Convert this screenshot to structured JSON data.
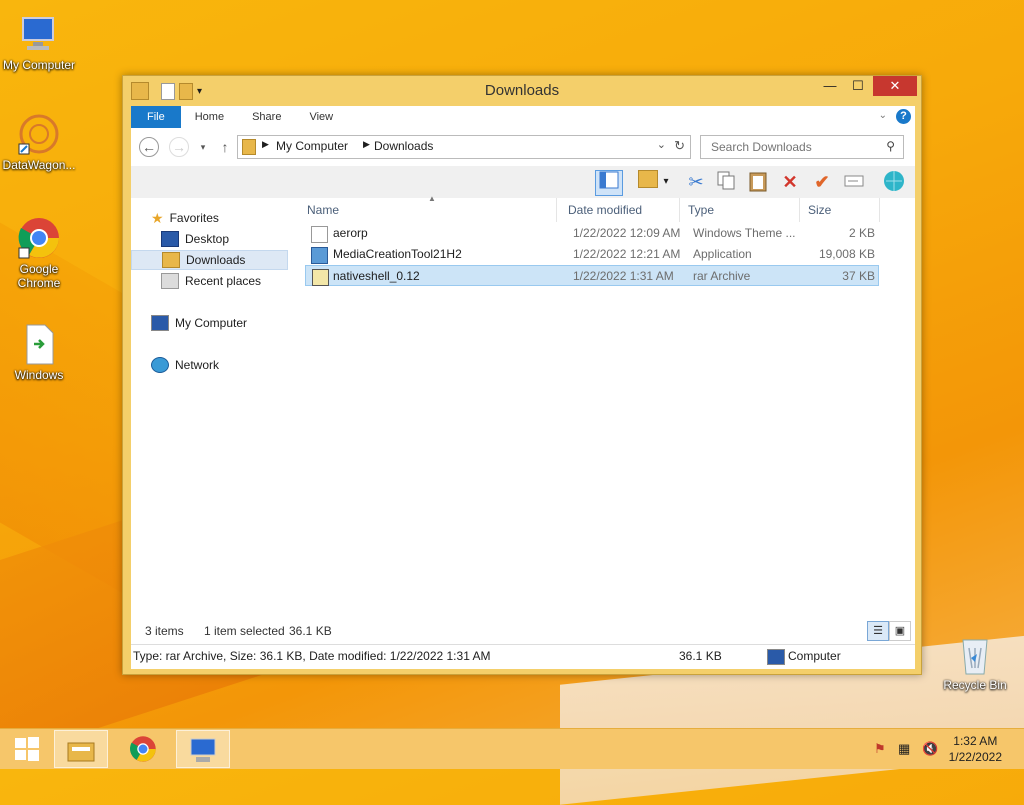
{
  "desktop": {
    "icons": [
      {
        "label": "My Computer"
      },
      {
        "label": "DataWagon..."
      },
      {
        "label": "Google Chrome"
      },
      {
        "label": "Windows"
      },
      {
        "label": "Recycle Bin"
      }
    ]
  },
  "window": {
    "title": "Downloads",
    "controls": {
      "minimize": "—",
      "maximize": "☐",
      "close": "✕"
    },
    "tabs": [
      {
        "label": "File"
      },
      {
        "label": "Home"
      },
      {
        "label": "Share"
      },
      {
        "label": "View"
      }
    ],
    "help": "?",
    "address": {
      "crumbs": [
        "My Computer",
        "Downloads"
      ]
    },
    "search": {
      "placeholder": "Search Downloads"
    },
    "nav": {
      "favorites": "Favorites",
      "desktop": "Desktop",
      "downloads": "Downloads",
      "recent": "Recent places",
      "computer": "My Computer",
      "network": "Network"
    },
    "columns": {
      "name": "Name",
      "date": "Date modified",
      "type": "Type",
      "size": "Size"
    },
    "files": [
      {
        "name": "aerorp",
        "date": "1/22/2022 12:09 AM",
        "type": "Windows Theme ...",
        "size": "2 KB"
      },
      {
        "name": "MediaCreationTool21H2",
        "date": "1/22/2022 12:21 AM",
        "type": "Application",
        "size": "19,008 KB"
      },
      {
        "name": "nativeshell_0.12",
        "date": "1/22/2022 1:31 AM",
        "type": "rar Archive",
        "size": "37 KB"
      }
    ],
    "status": {
      "items": "3 items",
      "selected": "1 item selected",
      "selsize": "36.1 KB"
    },
    "details": {
      "text": "Type: rar Archive, Size: 36.1 KB, Date modified: 1/22/2022 1:31 AM",
      "size": "36.1 KB",
      "location": "Computer"
    }
  },
  "taskbar": {
    "time": "1:32 AM",
    "date": "1/22/2022"
  }
}
